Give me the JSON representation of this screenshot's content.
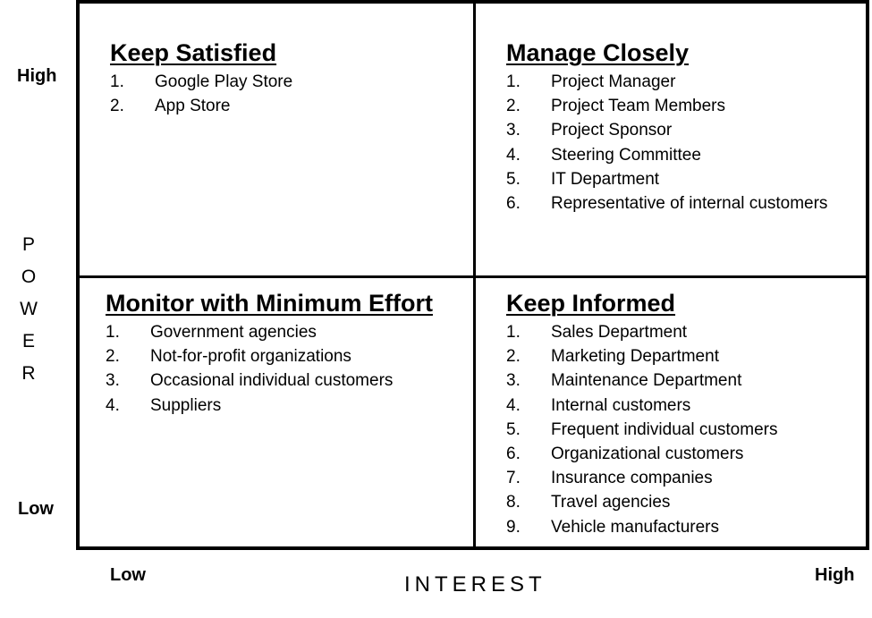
{
  "axes": {
    "power": {
      "title": "POWER",
      "high_label": "High",
      "low_label": "Low"
    },
    "interest": {
      "title": "INTEREST",
      "low_label": "Low",
      "high_label": "High"
    }
  },
  "quadrants": {
    "top_left": {
      "title": "Keep Satisfied",
      "items": [
        {
          "num": "1.",
          "text": "Google Play Store"
        },
        {
          "num": "2.",
          "text": "App Store"
        }
      ]
    },
    "top_right": {
      "title": "Manage Closely",
      "items": [
        {
          "num": "1.",
          "text": "Project Manager"
        },
        {
          "num": "2.",
          "text": "Project Team Members"
        },
        {
          "num": "3.",
          "text": "Project Sponsor"
        },
        {
          "num": "4.",
          "text": "Steering Committee"
        },
        {
          "num": "5.",
          "text": "IT Department"
        },
        {
          "num": "6.",
          "text": "Representative of internal customers"
        }
      ]
    },
    "bottom_left": {
      "title": "Monitor with Minimum Effort",
      "items": [
        {
          "num": "1.",
          "text": "Government agencies"
        },
        {
          "num": "2.",
          "text": "Not-for-profit organizations"
        },
        {
          "num": "3.",
          "text": "Occasional individual customers"
        },
        {
          "num": "4.",
          "text": "Suppliers"
        }
      ]
    },
    "bottom_right": {
      "title": "Keep Informed",
      "items": [
        {
          "num": "1.",
          "text": "Sales Department"
        },
        {
          "num": "2.",
          "text": "Marketing Department"
        },
        {
          "num": "3.",
          "text": "Maintenance Department"
        },
        {
          "num": "4.",
          "text": "Internal customers"
        },
        {
          "num": "5.",
          "text": "Frequent individual customers"
        },
        {
          "num": "6.",
          "text": "Organizational customers"
        },
        {
          "num": "7.",
          "text": "Insurance companies"
        },
        {
          "num": "8.",
          "text": "Travel agencies"
        },
        {
          "num": "9.",
          "text": "Vehicle manufacturers"
        }
      ]
    }
  }
}
